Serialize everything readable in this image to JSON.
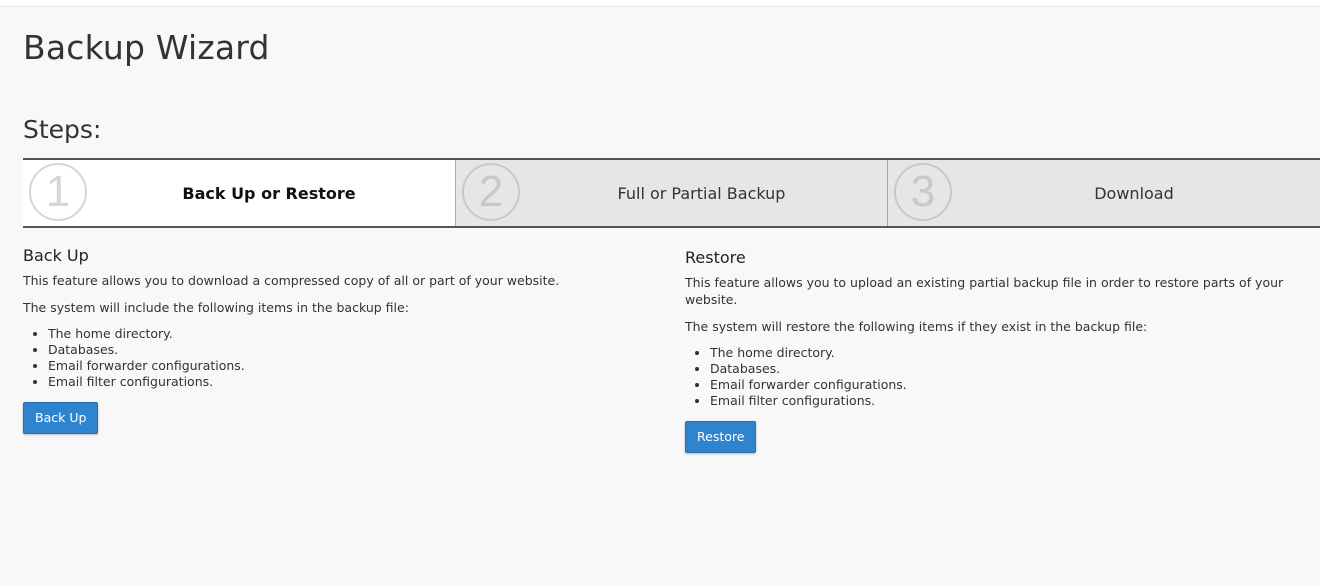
{
  "page": {
    "title": "Backup Wizard",
    "steps_heading": "Steps:"
  },
  "steps": [
    {
      "number": "1",
      "label": "Back Up or Restore",
      "active": true
    },
    {
      "number": "2",
      "label": "Full or Partial Backup",
      "active": false
    },
    {
      "number": "3",
      "label": "Download",
      "active": false
    }
  ],
  "backup": {
    "heading": "Back Up",
    "description": "This feature allows you to download a compressed copy of all or part of your website.",
    "list_intro": "The system will include the following items in the backup file:",
    "items": [
      "The home directory.",
      "Databases.",
      "Email forwarder configurations.",
      "Email filter configurations."
    ],
    "button_label": "Back Up"
  },
  "restore": {
    "heading": "Restore",
    "description": "This feature allows you to upload an existing partial backup file in order to restore parts of your website.",
    "list_intro": "The system will restore the following items if they exist in the backup file:",
    "items": [
      "The home directory.",
      "Databases.",
      "Email forwarder configurations.",
      "Email filter configurations."
    ],
    "button_label": "Restore"
  },
  "colors": {
    "primary_button": "#2f84cf",
    "active_step_bg": "#ffffff",
    "inactive_step_bg": "#e6e6e6",
    "page_bg": "#f8f8f8"
  }
}
